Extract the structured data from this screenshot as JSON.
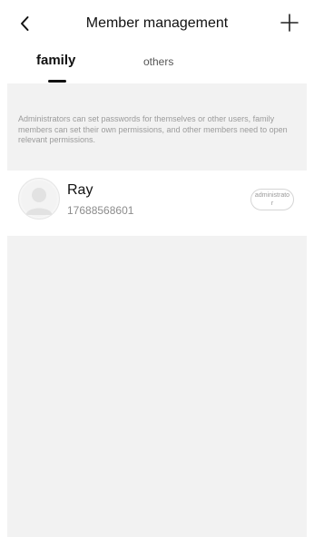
{
  "header": {
    "title": "Member management",
    "back_icon": "chevron-left-icon",
    "add_icon": "plus-icon"
  },
  "tabs": [
    {
      "label": "family",
      "active": true
    },
    {
      "label": "others",
      "active": false
    }
  ],
  "info": {
    "text": "Administrators can set passwords for themselves or other users, family members can set their own permissions, and other members need to open relevant permissions."
  },
  "members": [
    {
      "name": "Ray",
      "phone": "17688568601",
      "role": "administrator",
      "avatar_icon": "user-avatar-icon"
    }
  ],
  "colors": {
    "background": "#ffffff",
    "panel_gray": "#f2f2f2",
    "text_primary": "#111111",
    "text_secondary": "#8c8c8c"
  }
}
